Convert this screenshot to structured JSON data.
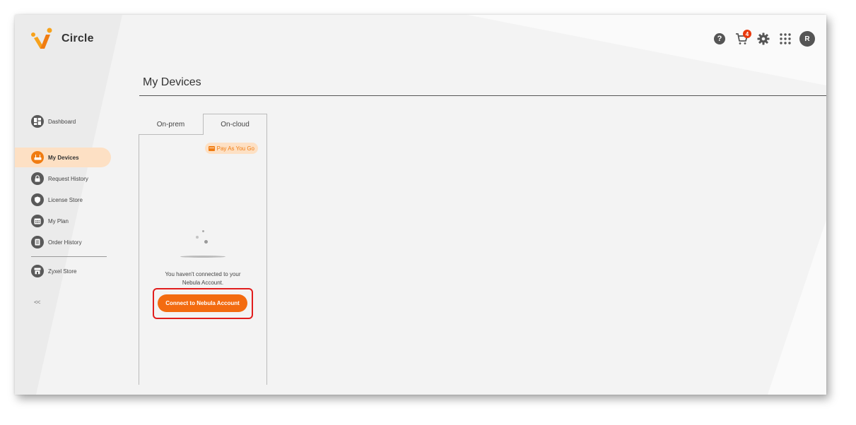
{
  "app": {
    "name": "Circle"
  },
  "header": {
    "icons": [
      "help-icon",
      "cart-icon",
      "gear-icon",
      "apps-grid-icon"
    ],
    "help_glyph": "?",
    "cart_badge": "4",
    "avatar_initial": "R"
  },
  "sidebar": {
    "items": [
      {
        "label": "Dashboard",
        "icon": "dashboard-icon",
        "active": false
      },
      {
        "label": "My Devices",
        "icon": "router-icon",
        "active": true
      },
      {
        "label": "Request History",
        "icon": "lock-icon",
        "active": false
      },
      {
        "label": "License Store",
        "icon": "shield-icon",
        "active": false
      },
      {
        "label": "My Plan",
        "icon": "calendar-icon",
        "active": false
      },
      {
        "label": "Order History",
        "icon": "list-icon",
        "active": false
      },
      {
        "label": "Zyxel Store",
        "icon": "store-icon",
        "active": false
      }
    ],
    "collapse_label": "<<"
  },
  "main": {
    "title": "My Devices",
    "tabs": [
      {
        "label": "On-prem",
        "selected": false
      },
      {
        "label": "On-cloud",
        "selected": true
      }
    ],
    "badge": "Pay As You Go",
    "empty_message_line1": "You haven't connected to your",
    "empty_message_line2": "Nebula Account.",
    "connect_button": "Connect to Nebula Account"
  },
  "colors": {
    "accent": "#f36b10",
    "active_bg": "#fde0c4",
    "highlight": "#e11d1d"
  }
}
